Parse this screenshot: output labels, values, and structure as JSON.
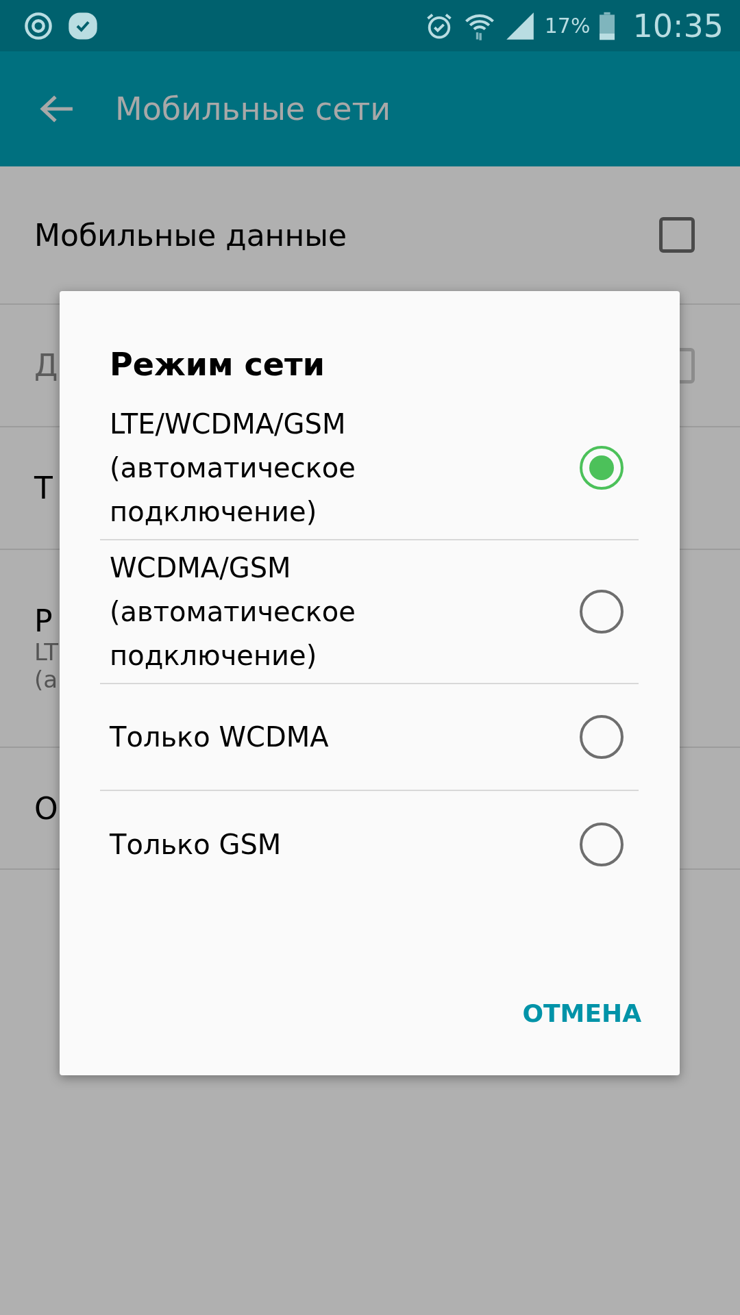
{
  "status_bar": {
    "battery": "17%",
    "time": "10:35"
  },
  "app_bar": {
    "title": "Мобильные сети"
  },
  "settings": [
    {
      "kind": "checkbox",
      "title": "Мобильные данные",
      "checked": false,
      "disabled": false
    },
    {
      "kind": "checkbox",
      "title": "Д",
      "checked": false,
      "disabled": true
    },
    {
      "kind": "text",
      "title": "Т"
    },
    {
      "kind": "text",
      "title": "Р",
      "subtitle_lines": [
        "LT",
        "(а"
      ]
    },
    {
      "kind": "text",
      "title": "О"
    }
  ],
  "dialog": {
    "title": "Режим сети",
    "options": [
      {
        "label": "LTE/WCDMA/GSM (автоматическое подключение)",
        "selected": true
      },
      {
        "label": "WCDMA/GSM (автоматическое подключение)",
        "selected": false
      },
      {
        "label": "Только WCDMA",
        "selected": false
      },
      {
        "label": "Только GSM",
        "selected": false
      }
    ],
    "buttons": [
      "ОТМЕНА"
    ]
  }
}
